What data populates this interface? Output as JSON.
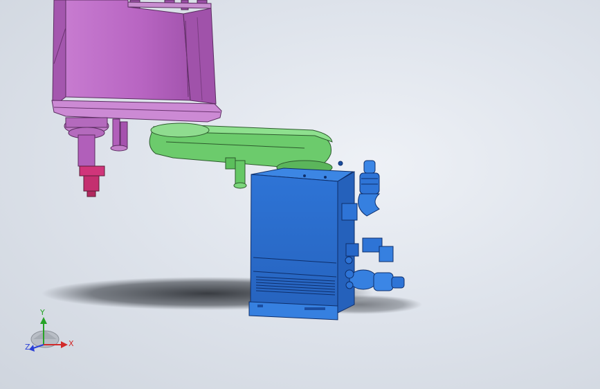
{
  "viewport": {
    "background_top": "#eef1f6",
    "background_bottom": "#cfd5de"
  },
  "model": {
    "robot_body_color": "#b86ac0",
    "robot_arm_color": "#6ccb6c",
    "controller_box_color": "#2f77d8",
    "connector_color": "#3b86e6",
    "flange_color": "#d0357a"
  },
  "triad": {
    "x_label": "X",
    "y_label": "Y",
    "z_label": "Z",
    "x_color": "#d22a2a",
    "y_color": "#26a326",
    "z_color": "#2a3fd6"
  }
}
